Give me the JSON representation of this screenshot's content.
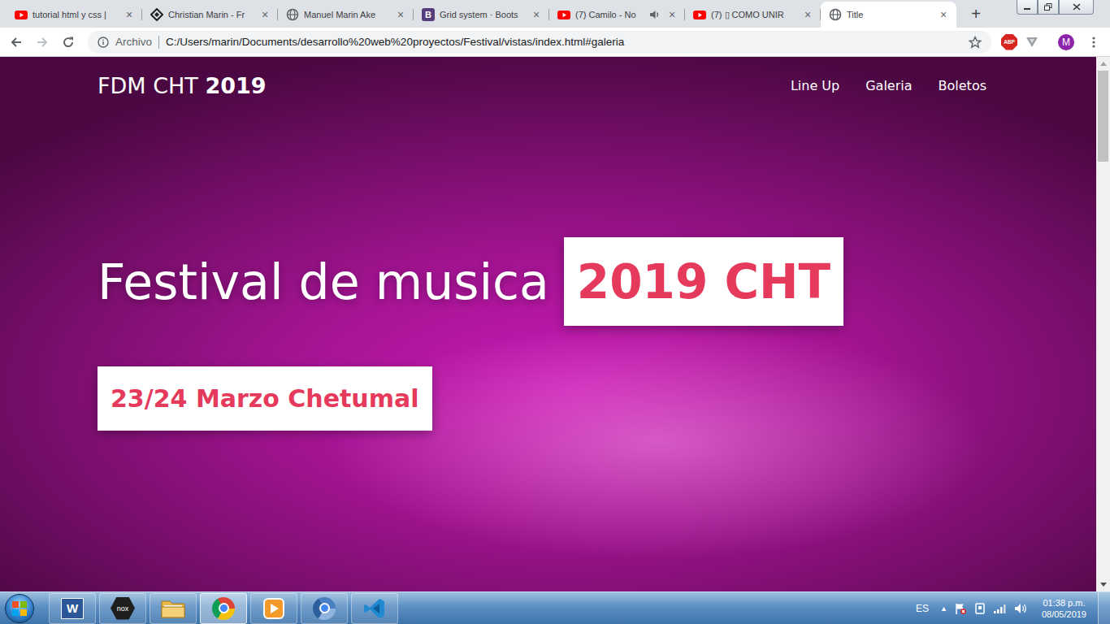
{
  "browser": {
    "tabs": [
      {
        "label": "tutorial html y css |",
        "kind": "youtube",
        "icon_letter": "",
        "audio": false,
        "selected": false
      },
      {
        "label": "Christian Marin - Fr",
        "kind": "diamond",
        "icon_letter": "",
        "audio": false,
        "selected": false
      },
      {
        "label": "Manuel Marin Ake",
        "kind": "globe",
        "icon_letter": "",
        "audio": false,
        "selected": false
      },
      {
        "label": "Grid system · Boots",
        "kind": "bootstrap",
        "icon_letter": "B",
        "audio": false,
        "selected": false
      },
      {
        "label": "(7) Camilo - No",
        "kind": "youtube",
        "icon_letter": "",
        "audio": true,
        "selected": false
      },
      {
        "label": "(7) ▯ COMO UNIR",
        "kind": "youtube",
        "icon_letter": "",
        "audio": false,
        "selected": false
      },
      {
        "label": "Title",
        "kind": "globe",
        "icon_letter": "",
        "audio": false,
        "selected": true
      }
    ],
    "tab_close": "×",
    "new_tab": "+",
    "nav": {
      "back_enabled": true,
      "forward_enabled": false
    },
    "address": {
      "scheme_label": "Archivo",
      "url": "C:/Users/marin/Documents/desarrollo%20web%20proyectos/Festival/vistas/index.html#galeria",
      "bookmarked": false
    },
    "extensions": [
      {
        "label": "ABP",
        "kind": "abp"
      },
      {
        "label": "",
        "kind": "v"
      }
    ],
    "profile": "M"
  },
  "page": {
    "brand": {
      "text": "FDM CHT ",
      "bold": "2019"
    },
    "nav": [
      {
        "label": "Line Up"
      },
      {
        "label": "Galeria"
      },
      {
        "label": "Boletos"
      }
    ],
    "title": "Festival de musica",
    "title_badge": "2019 CHT",
    "date_badge": "23/24 Marzo Chetumal",
    "scrollbar": {
      "level": 0.18
    }
  },
  "taskbar": {
    "apps": [
      {
        "kind": "word",
        "label": "W",
        "active": false
      },
      {
        "kind": "nox",
        "label": "nox",
        "active": false
      },
      {
        "kind": "folder",
        "label": "",
        "active": false
      },
      {
        "kind": "chrome",
        "label": "",
        "active": true
      },
      {
        "kind": "media",
        "label": "",
        "active": false
      },
      {
        "kind": "chrome-alt",
        "label": "",
        "active": false
      },
      {
        "kind": "vscode",
        "label": "",
        "active": false
      }
    ],
    "language": "ES",
    "tray_arrow": "▲",
    "clock": {
      "time": "01:38 p.m.",
      "date": "08/05/2019"
    }
  }
}
